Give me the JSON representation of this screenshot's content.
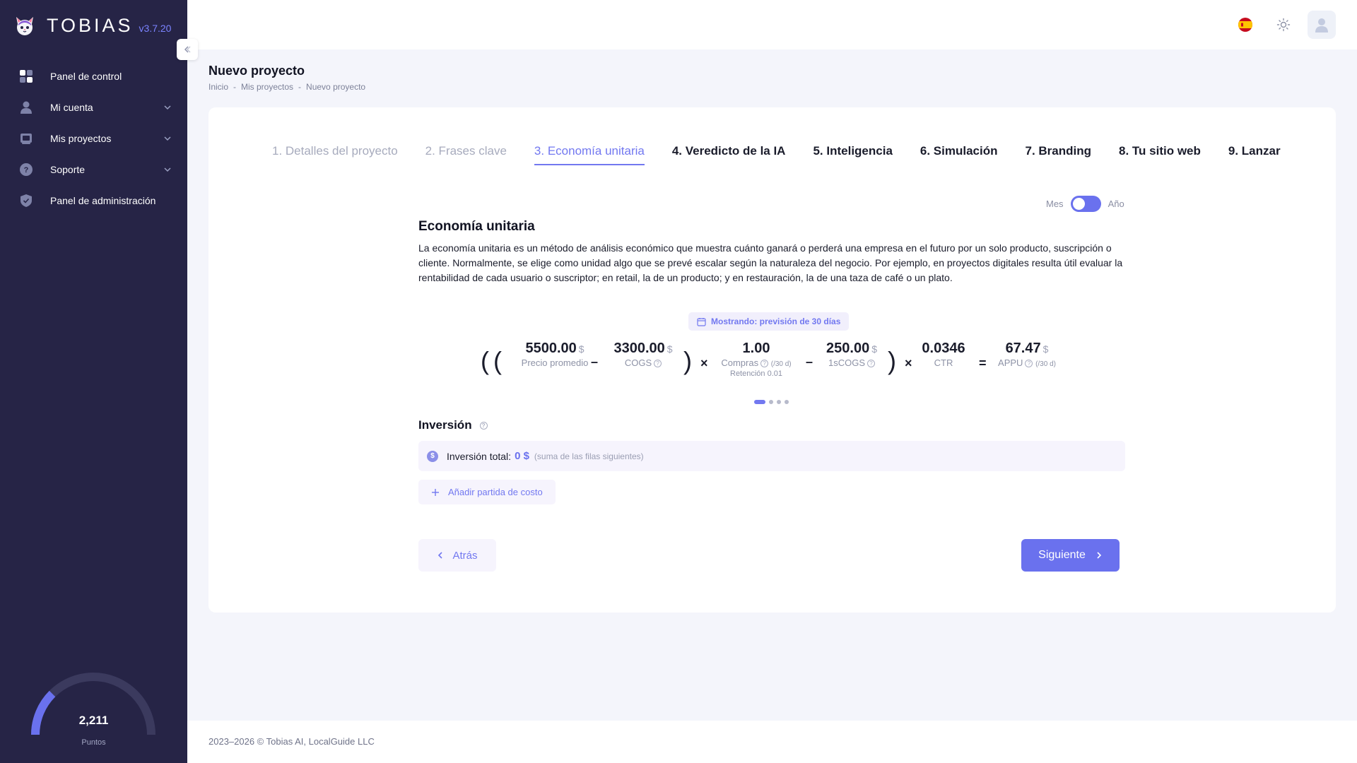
{
  "brand": {
    "name": "TOBIAS",
    "version": "v3.7.20"
  },
  "sidebar": {
    "items": [
      {
        "label": "Panel de control",
        "icon": "dashboard-icon",
        "has_children": false
      },
      {
        "label": "Mi cuenta",
        "icon": "user-icon",
        "has_children": true
      },
      {
        "label": "Mis proyectos",
        "icon": "projects-icon",
        "has_children": true
      },
      {
        "label": "Soporte",
        "icon": "help-icon",
        "has_children": true
      },
      {
        "label": "Panel de administración",
        "icon": "shield-icon",
        "has_children": false
      }
    ],
    "points": {
      "value": "2,211",
      "label": "Puntos",
      "fill_fraction": 0.25
    }
  },
  "header": {
    "language_flag": "spain-flag-icon",
    "theme_icon": "sun-icon",
    "avatar_icon": "user-avatar-icon"
  },
  "page": {
    "title": "Nuevo proyecto",
    "breadcrumb": [
      "Inicio",
      "Mis proyectos",
      "Nuevo proyecto"
    ],
    "breadcrumb_separator": "-"
  },
  "steps": [
    {
      "label": "1. Detalles del proyecto",
      "state": "done"
    },
    {
      "label": "2. Frases clave",
      "state": "done"
    },
    {
      "label": "3. Economía unitaria",
      "state": "active"
    },
    {
      "label": "4. Veredicto de la IA",
      "state": "pending"
    },
    {
      "label": "5. Inteligencia",
      "state": "pending"
    },
    {
      "label": "6. Simulación",
      "state": "pending"
    },
    {
      "label": "7. Branding",
      "state": "pending"
    },
    {
      "label": "8. Tu sitio web",
      "state": "pending"
    },
    {
      "label": "9. Lanzar",
      "state": "pending"
    }
  ],
  "period_toggle": {
    "left": "Mes",
    "right": "Año",
    "selected": "Mes"
  },
  "unit_economics": {
    "title": "Economía unitaria",
    "description": "La economía unitaria es un método de análisis económico que muestra cuánto ganará o perderá una empresa en el futuro por un solo producto, suscripción o cliente. Normalmente, se elige como unidad algo que se prevé escalar según la naturaleza del negocio. Por ejemplo, en proyectos digitales resulta útil evaluar la rentabilidad de cada usuario o suscriptor; en retail, la de un producto; y en restauración, la de una taza de café o un plato.",
    "forecast_badge": "Mostrando: previsión de 30 días",
    "formula": {
      "open_paren": "(",
      "close_paren": ")",
      "minus": "–",
      "times": "×",
      "equals": "=",
      "precio": {
        "value": "5500.00",
        "unit": "$",
        "label": "Precio promedio"
      },
      "cogs": {
        "value": "3300.00",
        "unit": "$",
        "label": "COGS",
        "help": "?"
      },
      "compras": {
        "value": "1.00",
        "label": "Compras",
        "help": "?",
        "hint": "(/30 d)",
        "sub": "Retención 0.01"
      },
      "onecogs": {
        "value": "250.00",
        "unit": "$",
        "label": "1sCOGS",
        "help": "?"
      },
      "ctr": {
        "value": "0.0346",
        "label": "CTR"
      },
      "appu": {
        "value": "67.47",
        "unit": "$",
        "label": "APPU",
        "help": "?",
        "hint": "(/30 d)"
      }
    },
    "carousel": {
      "total": 4,
      "active": 0
    }
  },
  "investment": {
    "title": "Inversión",
    "help": "?",
    "total_label": "Inversión total:",
    "total_value": "0 $",
    "total_hint": "(suma de las filas siguientes)",
    "add_label": "Añadir partida de costo",
    "currency_symbol": "$"
  },
  "nav_buttons": {
    "back": "Atrás",
    "next": "Siguiente"
  },
  "footer": {
    "text": "2023–2026 © Tobias AI, LocalGuide LLC"
  },
  "colors": {
    "sidebar_bg": "#262446",
    "accent": "#6a71ee",
    "accent_light": "#f6f4fd"
  }
}
